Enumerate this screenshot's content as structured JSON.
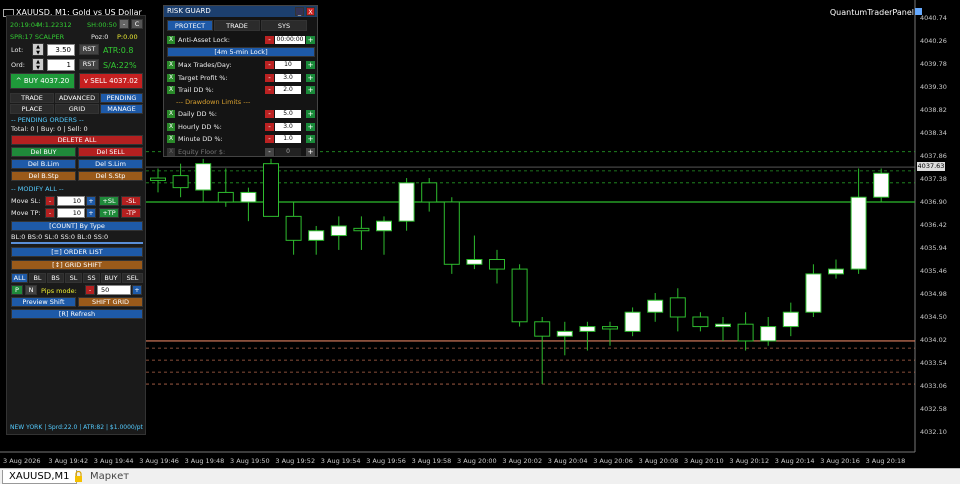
{
  "chart_header": {
    "symbol": "XAUUSD, M1:",
    "description": "Gold vs US Dollar",
    "brand": "QuantumTraderPanel"
  },
  "colors": {
    "ask": "#e08060",
    "bid": "#2ebc2e",
    "bull": "#ffffff",
    "bear": "#2ebc2e"
  },
  "price_axis": [
    "4040.74",
    "4040.26",
    "4039.78",
    "4039.30",
    "4038.82",
    "4038.34",
    "4037.86",
    "4037.38",
    "4036.90",
    "4036.42",
    "4035.94",
    "4035.46",
    "4034.98",
    "4034.50",
    "4034.02",
    "4033.54",
    "4033.06",
    "4032.58",
    "4032.10"
  ],
  "current_price": "4037.63",
  "time_axis": [
    "3 Aug 2026",
    "3 Aug 19:42",
    "3 Aug 19:44",
    "3 Aug 19:46",
    "3 Aug 19:48",
    "3 Aug 19:50",
    "3 Aug 19:52",
    "3 Aug 19:54",
    "3 Aug 19:56",
    "3 Aug 19:58",
    "3 Aug 20:00",
    "3 Aug 20:02",
    "3 Aug 20:04",
    "3 Aug 20:06",
    "3 Aug 20:08",
    "3 Aug 20:10",
    "3 Aug 20:12",
    "3 Aug 20:14",
    "3 Aug 20:16",
    "3 Aug 20:18"
  ],
  "chart_data": {
    "type": "candlestick",
    "candles": [
      {
        "o": 4037.4,
        "h": 4037.6,
        "l": 4037.1,
        "c": 4037.35
      },
      {
        "o": 4037.45,
        "h": 4037.7,
        "l": 4037.0,
        "c": 4037.2
      },
      {
        "o": 4037.15,
        "h": 4037.8,
        "l": 4036.9,
        "c": 4037.7
      },
      {
        "o": 4037.1,
        "h": 4037.6,
        "l": 4036.8,
        "c": 4036.9
      },
      {
        "o": 4036.9,
        "h": 4037.2,
        "l": 4036.5,
        "c": 4037.1
      },
      {
        "o": 4037.7,
        "h": 4037.8,
        "l": 4036.8,
        "c": 4036.6
      },
      {
        "o": 4036.6,
        "h": 4036.9,
        "l": 4035.8,
        "c": 4036.1
      },
      {
        "o": 4036.1,
        "h": 4036.4,
        "l": 4035.8,
        "c": 4036.3
      },
      {
        "o": 4036.2,
        "h": 4036.6,
        "l": 4035.9,
        "c": 4036.4
      },
      {
        "o": 4036.35,
        "h": 4036.6,
        "l": 4035.9,
        "c": 4036.3
      },
      {
        "o": 4036.3,
        "h": 4036.6,
        "l": 4035.8,
        "c": 4036.5
      },
      {
        "o": 4036.5,
        "h": 4037.4,
        "l": 4036.3,
        "c": 4037.3
      },
      {
        "o": 4037.3,
        "h": 4037.4,
        "l": 4036.7,
        "c": 4036.9
      },
      {
        "o": 4036.9,
        "h": 4037.0,
        "l": 4035.4,
        "c": 4035.6
      },
      {
        "o": 4035.6,
        "h": 4036.2,
        "l": 4035.5,
        "c": 4035.7
      },
      {
        "o": 4035.7,
        "h": 4035.9,
        "l": 4035.2,
        "c": 4035.5
      },
      {
        "o": 4035.5,
        "h": 4035.6,
        "l": 4034.3,
        "c": 4034.4
      },
      {
        "o": 4034.4,
        "h": 4034.5,
        "l": 4033.1,
        "c": 4034.1
      },
      {
        "o": 4034.1,
        "h": 4034.4,
        "l": 4033.7,
        "c": 4034.2
      },
      {
        "o": 4034.2,
        "h": 4034.4,
        "l": 4033.8,
        "c": 4034.3
      },
      {
        "o": 4034.3,
        "h": 4034.4,
        "l": 4033.9,
        "c": 4034.25
      },
      {
        "o": 4034.2,
        "h": 4034.7,
        "l": 4034.1,
        "c": 4034.6
      },
      {
        "o": 4034.6,
        "h": 4035.0,
        "l": 4034.4,
        "c": 4034.85
      },
      {
        "o": 4034.9,
        "h": 4035.1,
        "l": 4034.2,
        "c": 4034.5
      },
      {
        "o": 4034.5,
        "h": 4034.6,
        "l": 4034.2,
        "c": 4034.3
      },
      {
        "o": 4034.3,
        "h": 4034.5,
        "l": 4034.0,
        "c": 4034.35
      },
      {
        "o": 4034.35,
        "h": 4034.6,
        "l": 4033.8,
        "c": 4034.0
      },
      {
        "o": 4034.0,
        "h": 4034.5,
        "l": 4033.9,
        "c": 4034.3
      },
      {
        "o": 4034.3,
        "h": 4034.8,
        "l": 4034.1,
        "c": 4034.6
      },
      {
        "o": 4034.6,
        "h": 4035.6,
        "l": 4034.5,
        "c": 4035.4
      },
      {
        "o": 4035.4,
        "h": 4035.7,
        "l": 4035.3,
        "c": 4035.5
      },
      {
        "o": 4035.5,
        "h": 4037.6,
        "l": 4035.4,
        "c": 4037.0
      },
      {
        "o": 4037.0,
        "h": 4037.6,
        "l": 4036.9,
        "c": 4037.5
      }
    ],
    "ask_line": 4036.9,
    "bid_line": 4034.0,
    "level_lines": [
      4037.95,
      4037.55,
      4037.3,
      4033.85,
      4033.6,
      4033.35,
      4033.1
    ],
    "ylim": [
      4031.95,
      4040.9
    ]
  },
  "panel": {
    "clock": "20:19:04",
    "m_label": "M:1.22312",
    "spread": "SH:00:50",
    "min_label": "-",
    "c_label": "C",
    "spr_scalper": "SPR:17 SCALPER",
    "poz": "Poz:0",
    "p_val": "P:0.00",
    "lot_label": "Lot:",
    "lot_value": "3.50",
    "ord_label": "Ord:",
    "ord_value": "1",
    "rst": "RST",
    "atr": "ATR:0.8",
    "sa": "S/A:22%",
    "buy": "^ BUY  4037.20",
    "sell": "v SELL  4037.02",
    "tabs": [
      "TRADE",
      "ADVANCED",
      "PENDING",
      "PLACE",
      "GRID",
      "MANAGE"
    ],
    "pending_title": "-- PENDING ORDERS --",
    "totals": "Total: 0 | Buy: 0 | Sell: 0",
    "delete_all": "DELETE ALL",
    "del_buy": "Del BUY",
    "del_sell": "Del SELL",
    "del_blim": "Del B.Lim",
    "del_slim": "Del S.Lim",
    "del_bstp": "Del B.Stp",
    "del_sstp": "Del S.Stp",
    "modify_title": "-- MODIFY ALL --",
    "move_sl": "Move SL:",
    "move_tp": "Move TP:",
    "move_val": "10",
    "minus": "-",
    "plus": "+",
    "psl": "+SL",
    "msl": "-SL",
    "ptp": "+TP",
    "mtp": "-TP",
    "count_type": "[COUNT] By Type",
    "counts": "BL:0 BS:0 SL:0 SS:0 BL:0 SS:0",
    "order_list": "[≡] ORDER LIST",
    "grid_shift": "[↕] GRID SHIFT",
    "filters": [
      "ALL",
      "BL",
      "BS",
      "SL",
      "SS",
      "BUY",
      "SEL"
    ],
    "p_btn": "P",
    "n_btn": "N",
    "pips_mode": "Pips mode:",
    "pips_val": "50",
    "preview_shift": "Preview Shift",
    "shift_grid": "SHIFT GRID",
    "refresh": "[R] Refresh",
    "footer": "NEW YORK | Sprd:22.0 | ATR:82 | $1.0000/pt"
  },
  "risk_guard": {
    "title": "RISK GUARD",
    "minimize": "_",
    "close": "X",
    "tabs": [
      "PROTECT",
      "TRADE",
      "SYS"
    ],
    "anti_asset": "Anti-Asset Lock:",
    "anti_value": "00:00:00",
    "lock_bar": "[4m 5-min Lock]",
    "rows": [
      {
        "label": "Max Trades/Day:",
        "value": "10"
      },
      {
        "label": "Target Profit %:",
        "value": "3.0"
      },
      {
        "label": "Trail DD %:",
        "value": "2.0"
      }
    ],
    "dd_title": "--- Drawdown Limits ---",
    "dd_rows": [
      {
        "label": "Daily DD %:",
        "value": "5.0"
      },
      {
        "label": "Hourly DD %:",
        "value": "3.0"
      },
      {
        "label": "Minute DD %:",
        "value": "1.0"
      },
      {
        "label": "Equity Floor $:",
        "value": "0"
      }
    ],
    "x_label": "X"
  },
  "tabbar": {
    "tab": "XAUUSD,M1",
    "market": "Маркет"
  }
}
